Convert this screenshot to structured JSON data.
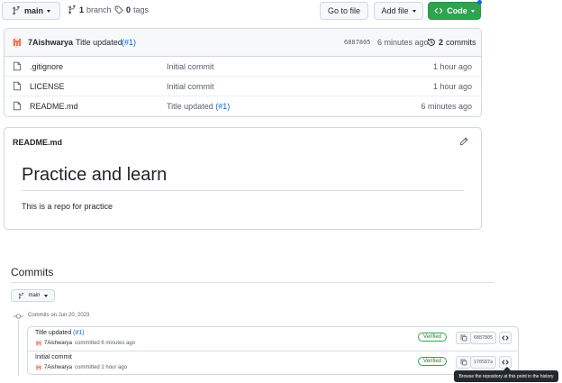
{
  "toolbar": {
    "branch_selector": "main",
    "branches_count": "1",
    "branches_label": "branch",
    "tags_count": "0",
    "tags_label": "tags",
    "go_to_file": "Go to file",
    "add_file": "Add file",
    "code": "Code"
  },
  "latest_commit": {
    "author": "7Aishwarya",
    "message": "Title updated",
    "pr_ref": "(#1)",
    "sha": "6887805",
    "age": "6 minutes ago",
    "commits_count": "2",
    "commits_label": "commits"
  },
  "files": [
    {
      "name": ".gitignore",
      "message": "Initial commit",
      "pr_ref": "",
      "age": "1 hour ago",
      "icon": "file-icon"
    },
    {
      "name": "LICENSE",
      "message": "Initial commit",
      "pr_ref": "",
      "age": "1 hour ago",
      "icon": "file-icon"
    },
    {
      "name": "README.md",
      "message": "Title updated",
      "pr_ref": "(#1)",
      "age": "6 minutes ago",
      "icon": "file-icon"
    }
  ],
  "readme": {
    "filename": "README.md",
    "heading": "Practice and learn",
    "body": "This is a repo for practice"
  },
  "commits_section": {
    "title": "Commits",
    "branch": "main",
    "date_group": "Commits on Jun 20, 2023",
    "items": [
      {
        "title": "Title updated",
        "pr_ref": "(#1)",
        "author": "7Aishwarya",
        "meta": "committed 6 minutes ago",
        "badge": "Verified",
        "sha": "6887805"
      },
      {
        "title": "Initial commit",
        "pr_ref": "",
        "author": "7Aishwarya",
        "meta": "committed 1 hour ago",
        "badge": "Verified",
        "sha": "170587a"
      }
    ]
  },
  "tooltip": "Browse the repository at this point in the history",
  "colors": {
    "code_button": "#2da44e",
    "link": "#0969da",
    "verified": "#1a7f37",
    "avatar": "#e07a5f",
    "notification_dot": "#0969da"
  }
}
